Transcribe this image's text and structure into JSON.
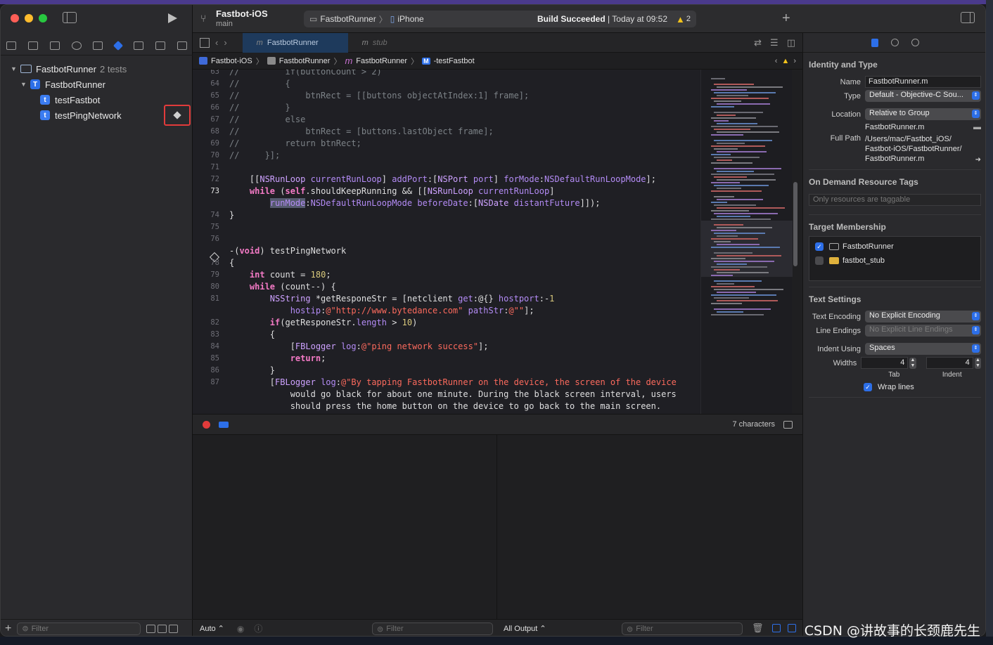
{
  "toolbar": {
    "project": "Fastbot-iOS",
    "branch": "main",
    "scheme": "FastbotRunner",
    "device": "iPhone",
    "build_status": "Build Succeeded",
    "build_time": "Today at 09:52",
    "warnings": "2"
  },
  "tabs": [
    {
      "label": "FastbotRunner",
      "icon": "m"
    },
    {
      "label": "stub",
      "icon": "m"
    }
  ],
  "jumpbar": [
    "Fastbot-iOS",
    "FastbotRunner",
    "FastbotRunner",
    "-testFastbot"
  ],
  "navigator": {
    "root": "FastbotRunner",
    "root_count": "2 tests",
    "target": "FastbotRunner",
    "tests": [
      "testFastbot",
      "testPingNetwork"
    ],
    "filter_placeholder": "Filter"
  },
  "editor": {
    "lines": [
      {
        "n": "63",
        "t": "//         if(buttonCount > 2)"
      },
      {
        "n": "64",
        "t": "//         {"
      },
      {
        "n": "65",
        "t": "//             btnRect = [[buttons objectAtIndex:1] frame];"
      },
      {
        "n": "66",
        "t": "//         }"
      },
      {
        "n": "67",
        "t": "//         else"
      },
      {
        "n": "68",
        "t": "//             btnRect = [buttons.lastObject frame];"
      },
      {
        "n": "69",
        "t": "//         return btnRect;"
      },
      {
        "n": "70",
        "t": "//     }];"
      },
      {
        "n": "71",
        "t": ""
      },
      {
        "n": "72",
        "t": "    [[NSRunLoop currentRunLoop] addPort:[NSPort port] forMode:NSDefaultRunLoopMode];"
      },
      {
        "n": "73",
        "t": "    while (self.shouldKeepRunning && [[NSRunLoop currentRunLoop]"
      },
      {
        "n": "",
        "t": "        runMode:NSDefaultRunLoopMode beforeDate:[NSDate distantFuture]]);"
      },
      {
        "n": "74",
        "t": "}"
      },
      {
        "n": "75",
        "t": ""
      },
      {
        "n": "76",
        "t": ""
      },
      {
        "n": "",
        "t": "-(void) testPingNetwork"
      },
      {
        "n": "78",
        "t": "{"
      },
      {
        "n": "79",
        "t": "    int count = 180;"
      },
      {
        "n": "80",
        "t": "    while (count--) {"
      },
      {
        "n": "81",
        "t": "        NSString *getResponeStr = [netclient get:@{} hostport:-1"
      },
      {
        "n": "",
        "t": "            hostip:@\"http://www.bytedance.com\" pathStr:@\"\"];"
      },
      {
        "n": "82",
        "t": "        if(getResponeStr.length > 10)"
      },
      {
        "n": "83",
        "t": "        {"
      },
      {
        "n": "84",
        "t": "            [FBLogger log:@\"ping network success\"];"
      },
      {
        "n": "85",
        "t": "            return;"
      },
      {
        "n": "86",
        "t": "        }"
      },
      {
        "n": "87",
        "t": "        [FBLogger log:@\"By tapping FastbotRunner on the device, the screen of the device"
      },
      {
        "n": "",
        "t": "            would go black for about one minute. During the black screen interval, users"
      },
      {
        "n": "",
        "t": "            should press the home button on the device to go back to the main screen."
      }
    ]
  },
  "debug": {
    "chars": "7 characters"
  },
  "console": {
    "left_mode": "Auto ⌃",
    "right_mode": "All Output ⌃",
    "filter_placeholder": "Filter"
  },
  "inspector": {
    "identity_title": "Identity and Type",
    "name_label": "Name",
    "name_value": "FastbotRunner.m",
    "type_label": "Type",
    "type_value": "Default - Objective-C Sou...",
    "location_label": "Location",
    "location_value": "Relative to Group",
    "location_file": "FastbotRunner.m",
    "fullpath_label": "Full Path",
    "fullpath_value": "/Users/mac/Fastbot_iOS/ Fastbot-iOS/FastbotRunner/ FastbotRunner.m",
    "odr_title": "On Demand Resource Tags",
    "odr_placeholder": "Only resources are taggable",
    "membership_title": "Target Membership",
    "members": [
      {
        "name": "FastbotRunner",
        "checked": true
      },
      {
        "name": "fastbot_stub",
        "checked": false
      }
    ],
    "text_title": "Text Settings",
    "encoding_label": "Text Encoding",
    "encoding_value": "No Explicit Encoding",
    "endings_label": "Line Endings",
    "endings_value": "No Explicit Line Endings",
    "indent_label": "Indent Using",
    "indent_value": "Spaces",
    "widths_label": "Widths",
    "tab_width": "4",
    "indent_width": "4",
    "tab_label": "Tab",
    "indent_sub_label": "Indent",
    "wrap_label": "Wrap lines"
  },
  "watermark": "CSDN @讲故事的长颈鹿先生",
  "colors": {
    "accent": "#2d6fe8",
    "breakpoint": "#e23b3b",
    "warning": "#f2c31b"
  }
}
